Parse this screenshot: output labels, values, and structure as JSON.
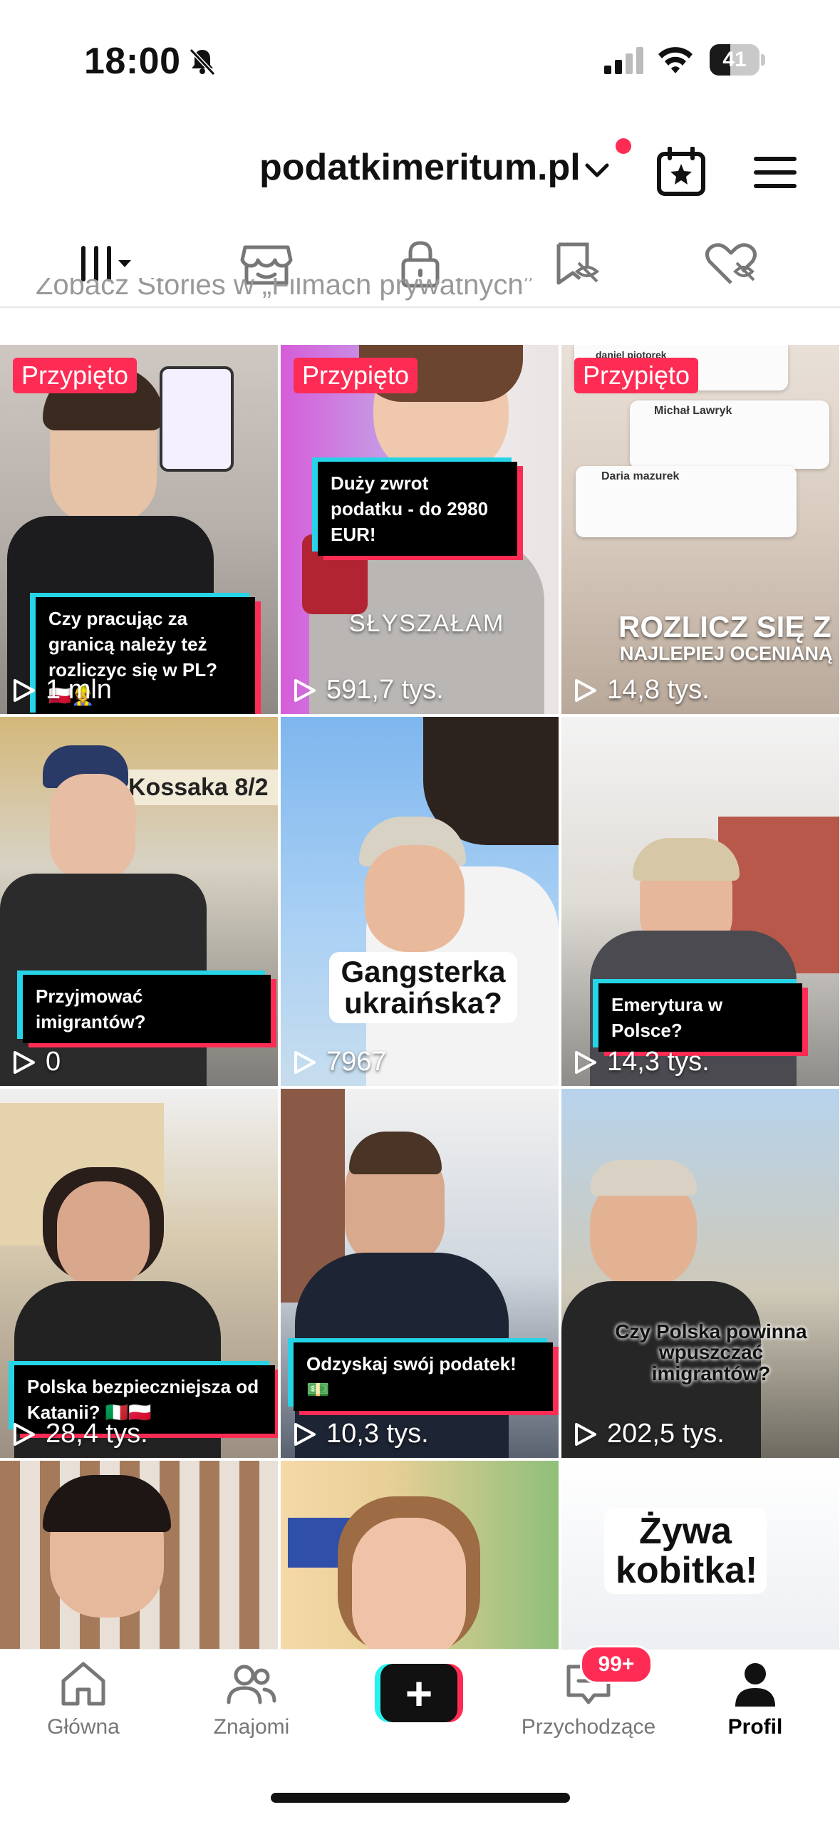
{
  "status_bar": {
    "time": "18:00",
    "battery_level": "41",
    "battery_fraction": 0.41
  },
  "header": {
    "username": "podatkimeritum.pl"
  },
  "tabs": [
    "videos-grid",
    "shop",
    "private",
    "reposts",
    "liked"
  ],
  "peek_text": "Zobacz Stories w „Filmach prywatnych”",
  "videos": [
    {
      "pinned": "Przypięto",
      "caption": "Czy pracując za granicą należy też rozliczyc się w PL? 🇵🇱👷",
      "views": "1 mln"
    },
    {
      "pinned": "Przypięto",
      "caption": "Duży zwrot podatku - do 2980 EUR!",
      "overlay": "SŁYSZAŁAM",
      "views": "591,7 tys."
    },
    {
      "pinned": "Przypięto",
      "overlay": "ROZLICZ SIĘ Z",
      "overlay2": "NAJLEPIEJ OCENIANĄ",
      "views": "14,8 tys.",
      "review1_name": "Michał Lawryk",
      "review2_name": "Daria mazurek",
      "review0_name": "daniel piotorek"
    },
    {
      "caption": "Przyjmować imigrantów?",
      "views": "0",
      "sign": "Kossaka 8/2"
    },
    {
      "bigcaption": "Gangsterka ukraińska?",
      "views": "7967"
    },
    {
      "caption": "Emerytura w Polsce?",
      "views": "14,3 tys."
    },
    {
      "caption": "Polska bezpieczniejsza od Katanii? 🇮🇹🇵🇱",
      "views": "28,4 tys."
    },
    {
      "caption": "Odzyskaj swój podatek! 💵",
      "views": "10,3 tys."
    },
    {
      "bigcaption": "Czy Polska powinna wpuszczać imigrantów?",
      "views": "202,5 tys."
    },
    {
      "views": ""
    },
    {
      "views": ""
    },
    {
      "bigcaption": "Żywa kobitka!",
      "views": ""
    }
  ],
  "nav": {
    "home": "Główna",
    "friends": "Znajomi",
    "inbox": "Przychodzące",
    "inbox_badge": "99+",
    "profile": "Profil"
  },
  "colors": {
    "accent": "#fe2c55",
    "cyan": "#25d4e6"
  }
}
